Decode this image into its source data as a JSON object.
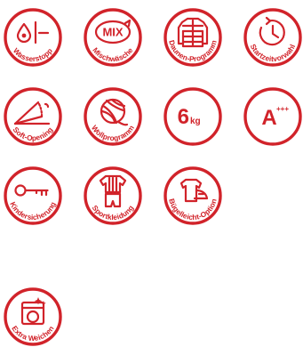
{
  "theme": {
    "accent": "#d1232a",
    "background": "#ffffff"
  },
  "badges": [
    {
      "label": "Wasserstopp",
      "icon": "water-stop-icon"
    },
    {
      "label": "Mischwäsche",
      "icon": "mix-icon",
      "glyph": "MIX"
    },
    {
      "label": "Daunen-Programm",
      "icon": "down-jacket-icon"
    },
    {
      "label": "Startzeitvorwahl",
      "icon": "timer-icon"
    },
    {
      "label": "Soft-Opening",
      "icon": "soft-opening-icon"
    },
    {
      "label": "Wollprogramm",
      "icon": "wool-ball-icon"
    },
    {
      "label": "",
      "icon": "capacity-icon",
      "glyph": "6",
      "unit": "kg"
    },
    {
      "label": "",
      "icon": "energy-class-icon",
      "glyph": "A",
      "sup": "+++"
    },
    {
      "label": "Kindersicherung",
      "icon": "key-icon"
    },
    {
      "label": "Sportkleidung",
      "icon": "sportswear-icon"
    },
    {
      "label": "Bügelleicht-Option",
      "icon": "easy-iron-icon"
    },
    {
      "label": "Extra Weichen",
      "icon": "extra-soft-icon"
    }
  ]
}
